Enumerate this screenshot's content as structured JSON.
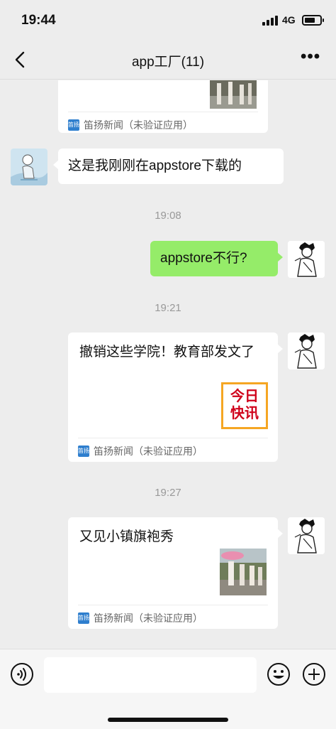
{
  "status": {
    "time": "19:44",
    "network": "4G"
  },
  "nav": {
    "title": "app工厂(11)",
    "more": "•••"
  },
  "messages": {
    "card0": {
      "app_name": "笛扬新闻（未验证应用）",
      "badge": "笛扬"
    },
    "m1": {
      "text": "这是我刚刚在appstore下载的"
    },
    "t1": "19:08",
    "m2": {
      "text": "appstore不行?"
    },
    "t2": "19:21",
    "card1": {
      "title": "撤销这些学院！教育部发文了",
      "thumb_line1": "今日",
      "thumb_line2": "快讯",
      "app_name": "笛扬新闻（未验证应用）",
      "badge": "笛扬"
    },
    "t3": "19:27",
    "card2": {
      "title": "又见小镇旗袍秀",
      "app_name": "笛扬新闻（未验证应用）",
      "badge": "笛扬"
    }
  },
  "input": {
    "placeholder": ""
  },
  "colors": {
    "bubble_green": "#95ec69",
    "background": "#ededed",
    "badge_blue": "#2f7fce",
    "kuaixun_orange": "#f5a623",
    "kuaixun_red": "#d0021b"
  },
  "icons": [
    "back-icon",
    "more-icon",
    "voice-icon",
    "emoji-icon",
    "plus-icon"
  ]
}
